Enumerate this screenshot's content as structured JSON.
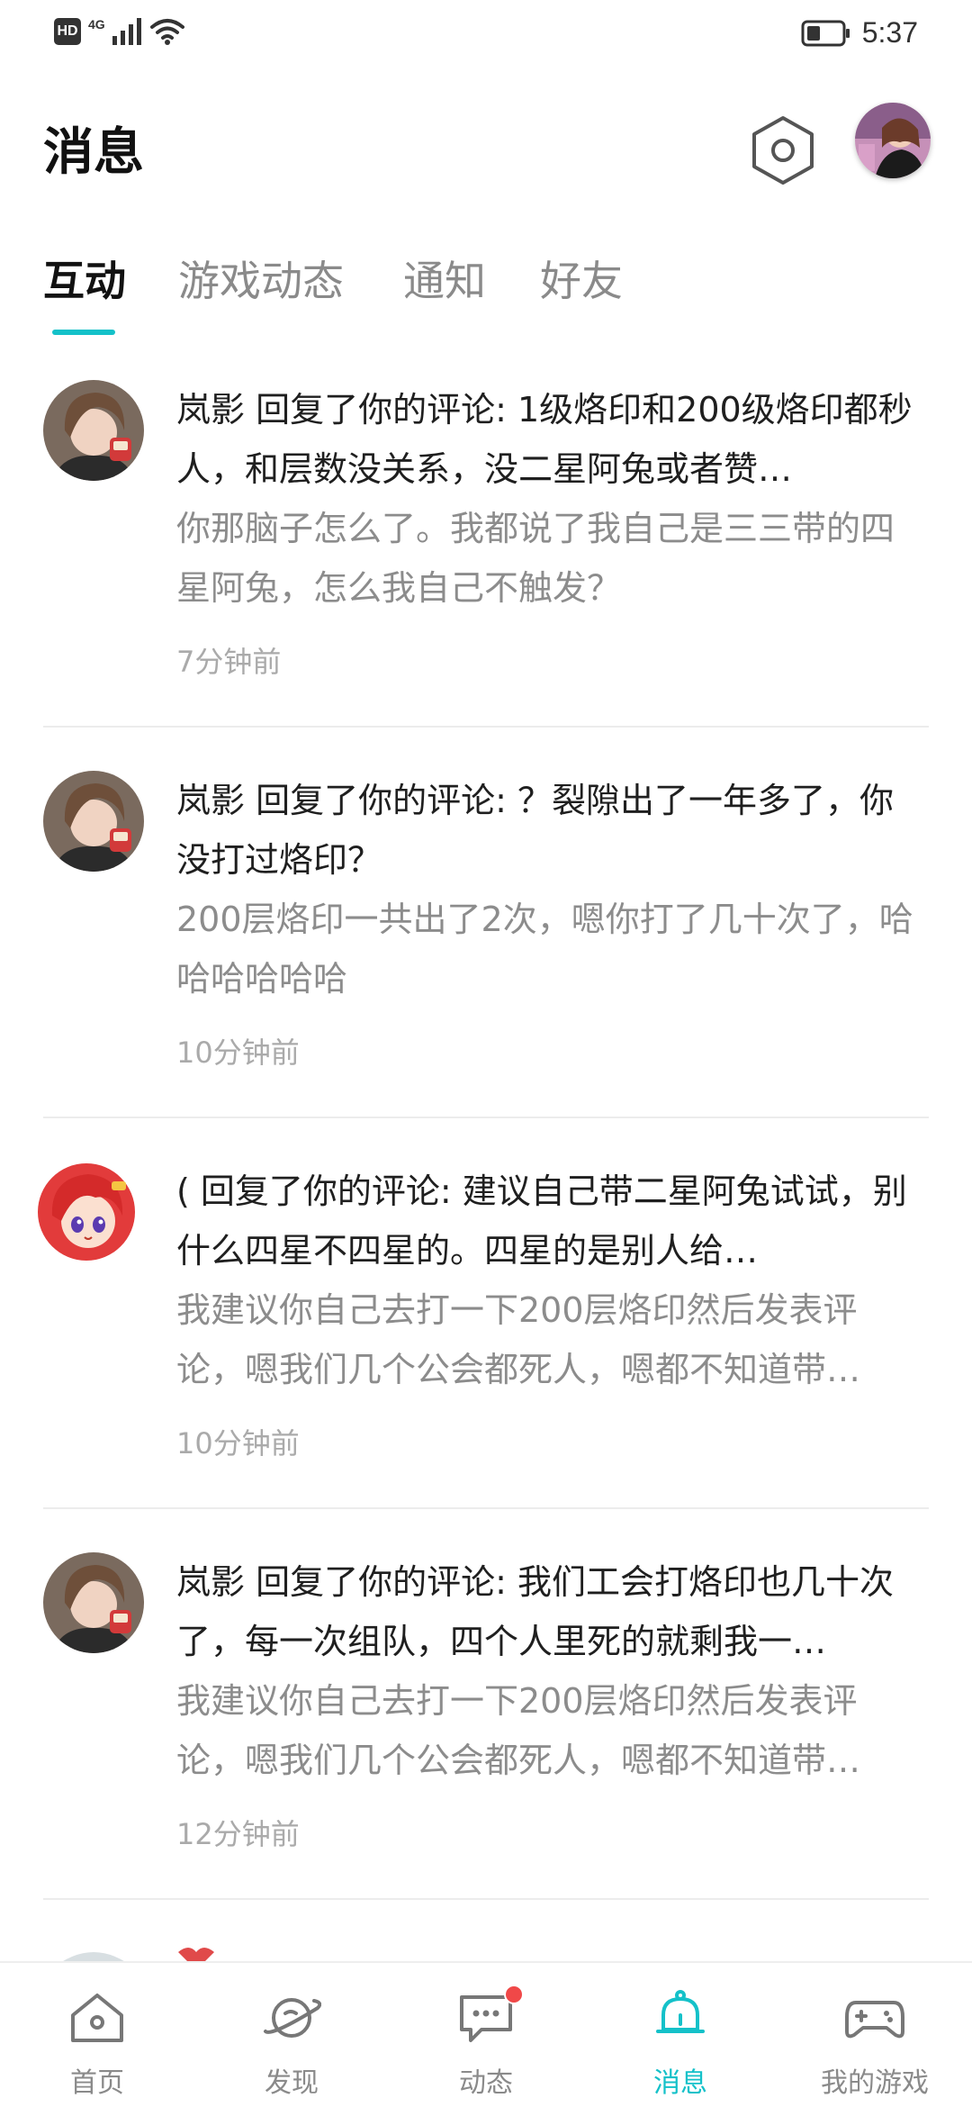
{
  "status_bar": {
    "hd": "HD",
    "network": "4G",
    "time": "5:37"
  },
  "header": {
    "title": "消息"
  },
  "tabs": [
    {
      "label": "互动",
      "active": true
    },
    {
      "label": "游戏动态",
      "active": false
    },
    {
      "label": "通知",
      "active": false
    },
    {
      "label": "好友",
      "active": false
    }
  ],
  "messages": [
    {
      "title": "岚影 回复了你的评论: 1级烙印和200级烙印都秒人，和层数没关系，没二星阿兔或者赞…",
      "reply": "你那脑子怎么了。我都说了我自己是三三带的四星阿兔，怎么我自己不触发？",
      "time": "7分钟前",
      "avatar": "user-photo-avatar"
    },
    {
      "title": "岚影 回复了你的评论: ？裂隙出了一年多了，你没打过烙印？",
      "reply": "200层烙印一共出了2次，嗯你打了几十次了，哈哈哈哈哈哈",
      "time": "10分钟前",
      "avatar": "user-photo-avatar"
    },
    {
      "title": "( 回复了你的评论: 建议自己带二星阿兔试试，别什么四星不四星的。四星的是别人给…",
      "reply": "我建议你自己去打一下200层烙印然后发表评论，嗯我们几个公会都死人，嗯都不知道带…",
      "time": "10分钟前",
      "avatar": "anime-character-avatar"
    },
    {
      "title": "岚影 回复了你的评论: 我们工会打烙印也几十次了，每一次组队，四个人里死的就剩我一…",
      "reply": "我建议你自己去打一下200层烙印然后发表评论，嗯我们几个公会都死人，嗯都不知道带…",
      "time": "12分钟前",
      "avatar": "user-photo-avatar"
    }
  ],
  "bottom_nav": [
    {
      "label": "首页",
      "icon": "home-icon",
      "active": false
    },
    {
      "label": "发现",
      "icon": "planet-icon",
      "active": false
    },
    {
      "label": "动态",
      "icon": "chat-bubble-icon",
      "active": false,
      "badge": true
    },
    {
      "label": "消息",
      "icon": "bell-icon",
      "active": true
    },
    {
      "label": "我的游戏",
      "icon": "gamepad-icon",
      "active": false
    }
  ],
  "colors": {
    "accent": "#14c1c9",
    "badge": "#f04848",
    "text_primary": "#1f1f1f",
    "text_secondary": "#8c8c8c",
    "text_time": "#aaaaaa"
  }
}
